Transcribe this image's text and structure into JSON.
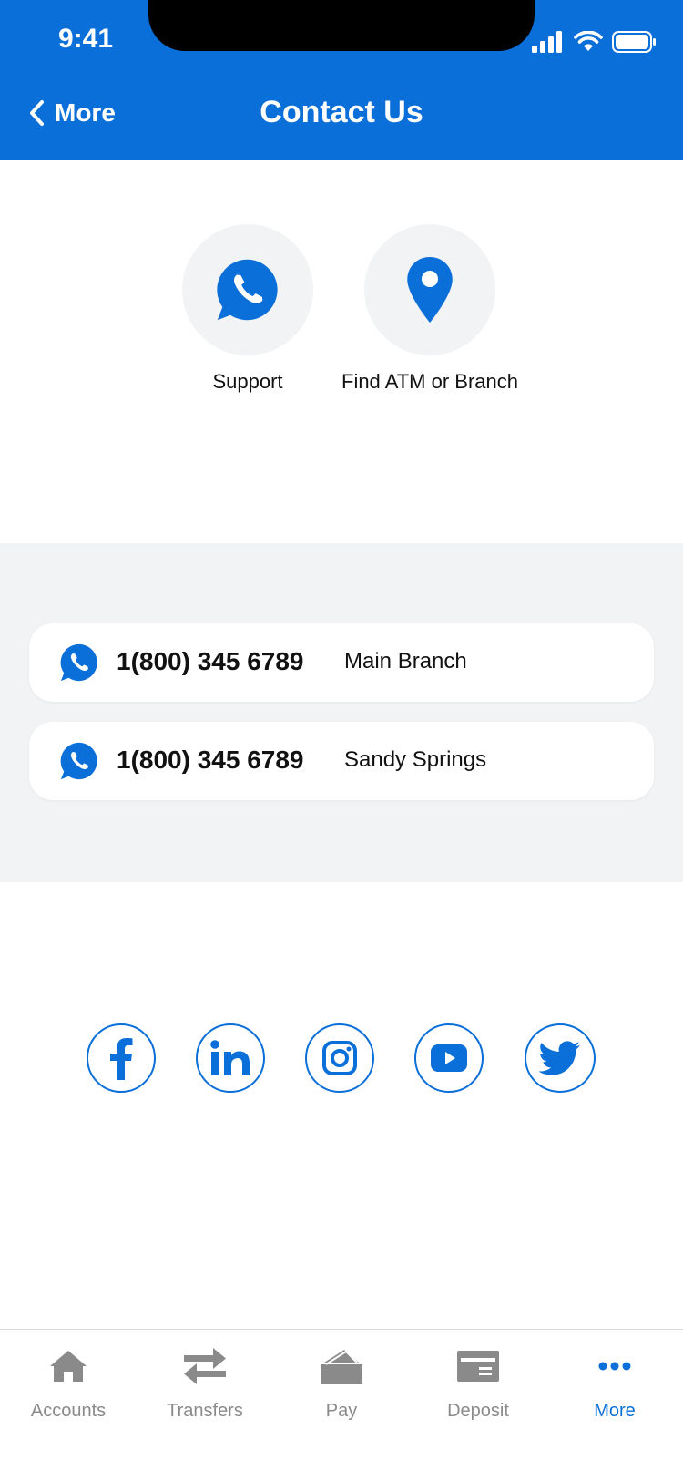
{
  "status_bar": {
    "time": "9:41"
  },
  "header": {
    "back_label": "More",
    "title": "Contact Us"
  },
  "quick_actions": [
    {
      "label": "Support",
      "icon": "whatsapp-phone-icon"
    },
    {
      "label": "Find ATM or Branch",
      "icon": "location-pin-icon"
    }
  ],
  "phones": [
    {
      "number": "1(800) 345 6789",
      "branch": "Main Branch"
    },
    {
      "number": "1(800) 345 6789",
      "branch": "Sandy Springs"
    }
  ],
  "social": [
    "facebook-icon",
    "linkedin-icon",
    "instagram-icon",
    "youtube-icon",
    "twitter-icon"
  ],
  "tabs": [
    {
      "label": "Accounts",
      "icon": "home-icon"
    },
    {
      "label": "Transfers",
      "icon": "transfer-arrows-icon"
    },
    {
      "label": "Pay",
      "icon": "pay-icon"
    },
    {
      "label": "Deposit",
      "icon": "check-deposit-icon"
    },
    {
      "label": "More",
      "icon": "more-dots-icon",
      "active": true
    }
  ],
  "colors": {
    "brand": "#0A6FD9",
    "section_bg": "#F2F3F5",
    "inactive": "#8A8A8A"
  }
}
